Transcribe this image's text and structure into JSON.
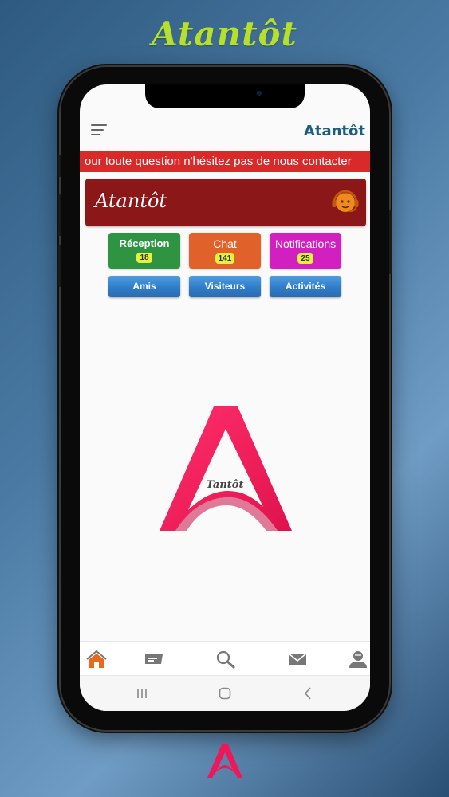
{
  "page": {
    "brand_title": "Atantôt"
  },
  "app": {
    "title": "Atantôt",
    "marquee_text": "our toute question n'hésitez pas de nous contacter",
    "banner_title": "Atantôt",
    "logo_caption": "Tantôt"
  },
  "tiles": [
    {
      "label": "Réception",
      "count": "18",
      "color": "#2e9442"
    },
    {
      "label": "Chat",
      "count": "141",
      "color": "#e0622a"
    },
    {
      "label": "Notifications",
      "count": "25",
      "color": "#d21fc0"
    }
  ],
  "buttons": [
    {
      "label": "Amis"
    },
    {
      "label": "Visiteurs"
    },
    {
      "label": "Activités"
    }
  ],
  "bottom_nav": [
    {
      "icon": "home-icon",
      "active": true
    },
    {
      "icon": "chat-icon",
      "active": false
    },
    {
      "icon": "search-icon",
      "active": false
    },
    {
      "icon": "mail-icon",
      "active": false
    },
    {
      "icon": "profile-icon",
      "active": false
    }
  ],
  "system_nav": [
    {
      "icon": "recent-apps-icon"
    },
    {
      "icon": "home-button-icon"
    },
    {
      "icon": "back-icon"
    }
  ],
  "colors": {
    "accent_pink": "#ee1c5a",
    "brand_title_green": "#b7e02a",
    "appbar_title_blue": "#1d5d80",
    "marquee_red": "#d92a2a",
    "banner_red": "#8c1718",
    "nav_active_orange": "#e8691c"
  }
}
